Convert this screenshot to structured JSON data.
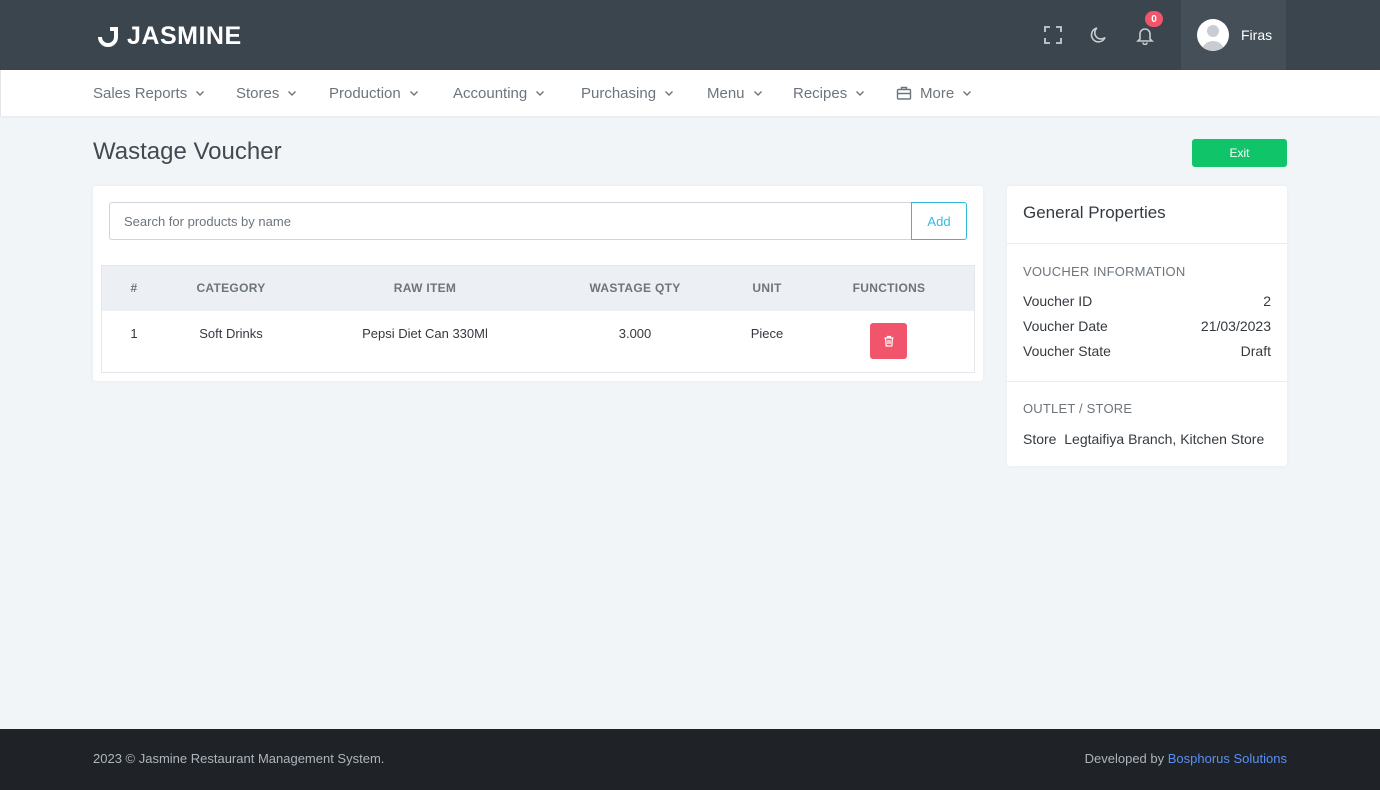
{
  "app": {
    "name": "JASMINE",
    "notification_count": "0",
    "user_name": "Firas"
  },
  "nav": {
    "items": [
      {
        "label": "Sales Reports"
      },
      {
        "label": "Stores"
      },
      {
        "label": "Production"
      },
      {
        "label": "Accounting"
      },
      {
        "label": "Purchasing"
      },
      {
        "label": "Menu"
      },
      {
        "label": "Recipes"
      },
      {
        "label": "More",
        "icon": "briefcase-icon"
      }
    ]
  },
  "page": {
    "title": "Wastage Voucher",
    "exit_label": "Exit"
  },
  "search": {
    "placeholder": "Search for products by name",
    "value": "",
    "add_label": "Add"
  },
  "table": {
    "columns": [
      "#",
      "CATEGORY",
      "RAW ITEM",
      "WASTAGE QTY",
      "UNIT",
      "FUNCTIONS"
    ],
    "rows": [
      {
        "index": "1",
        "category": "Soft Drinks",
        "raw_item": "Pepsi Diet Can 330Ml",
        "qty": "3.000",
        "unit": "Piece"
      }
    ]
  },
  "properties": {
    "title": "General Properties",
    "voucher_section": "VOUCHER INFORMATION",
    "voucher_id_label": "Voucher ID",
    "voucher_id": "2",
    "voucher_date_label": "Voucher Date",
    "voucher_date": "21/03/2023",
    "voucher_state_label": "Voucher State",
    "voucher_state": "Draft",
    "outlet_section": "OUTLET / STORE",
    "store_label": "Store",
    "store_value": "Legtaifiya Branch, Kitchen Store"
  },
  "footer": {
    "copyright": "2023 © Jasmine Restaurant Management System.",
    "developed_by": "Developed by",
    "developer": "Bosphorus Solutions"
  },
  "colors": {
    "topbar": "#3a454d",
    "success": "#10c469",
    "danger": "#f1556c",
    "info": "#35b8e0",
    "link": "#5b8ff0"
  }
}
